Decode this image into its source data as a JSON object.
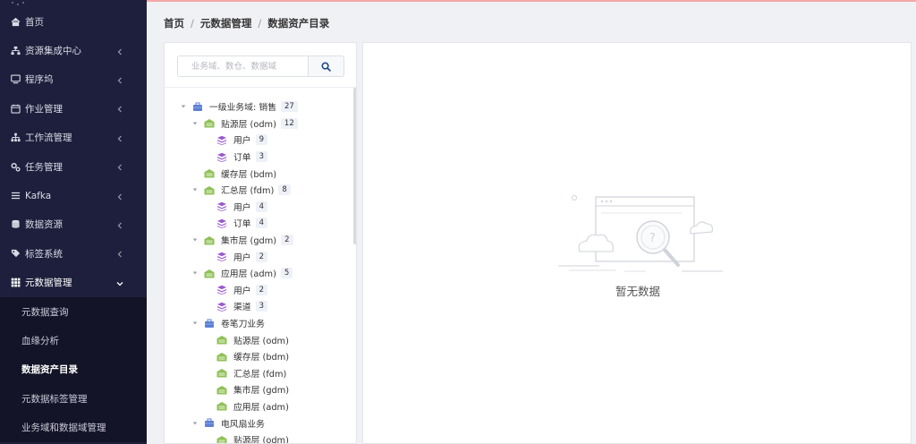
{
  "colors": {
    "sidebar_bg": "#1e1f3c",
    "submenu_bg": "#141428",
    "layer_icon": "#8fc157",
    "table_icon": "#9b59d0",
    "domain_icon": "#5b7fd4",
    "accent_line": "#f4a7a7"
  },
  "sidebar": {
    "items": [
      {
        "label": "首页",
        "icon": "home-icon",
        "has_arrow": false
      },
      {
        "label": "资源集成中心",
        "icon": "sitemap-icon",
        "has_arrow": true
      },
      {
        "label": "程序坞",
        "icon": "monitor-icon",
        "has_arrow": true
      },
      {
        "label": "作业管理",
        "icon": "calendar-icon",
        "has_arrow": true
      },
      {
        "label": "工作流管理",
        "icon": "hierarchy-icon",
        "has_arrow": true
      },
      {
        "label": "任务管理",
        "icon": "gears-icon",
        "has_arrow": true
      },
      {
        "label": "Kafka",
        "icon": "list-icon",
        "has_arrow": true
      },
      {
        "label": "数据资源",
        "icon": "database-icon",
        "has_arrow": true
      },
      {
        "label": "标签系统",
        "icon": "tag-icon",
        "has_arrow": true
      },
      {
        "label": "元数据管理",
        "icon": "grid-icon",
        "has_arrow": true,
        "open": true
      }
    ],
    "submenu": [
      {
        "label": "元数据查询",
        "active": false
      },
      {
        "label": "血缘分析",
        "active": false
      },
      {
        "label": "数据资产目录",
        "active": true
      },
      {
        "label": "元数据标签管理",
        "active": false
      },
      {
        "label": "业务域和数据域管理",
        "active": false
      }
    ]
  },
  "breadcrumb": {
    "home": "首页",
    "sep": "/",
    "parent": "元数据管理",
    "current": "数据资产目录"
  },
  "search": {
    "placeholder": "业务域、数仓、数据域",
    "button_icon": "search-icon"
  },
  "tree": [
    {
      "level": 0,
      "label": "一级业务域: 销售",
      "count": "27",
      "icon": "domain",
      "arrow": true
    },
    {
      "level": 1,
      "label": "贴源层 (odm)",
      "count": "12",
      "icon": "layer",
      "arrow": true
    },
    {
      "level": 2,
      "label": "用户",
      "count": "9",
      "icon": "table",
      "arrow": false
    },
    {
      "level": 2,
      "label": "订单",
      "count": "3",
      "icon": "table",
      "arrow": false
    },
    {
      "level": 1,
      "label": "缓存层 (bdm)",
      "count": "",
      "icon": "layer",
      "arrow": false
    },
    {
      "level": 1,
      "label": "汇总层 (fdm)",
      "count": "8",
      "icon": "layer",
      "arrow": true
    },
    {
      "level": 2,
      "label": "用户",
      "count": "4",
      "icon": "table",
      "arrow": false
    },
    {
      "level": 2,
      "label": "订单",
      "count": "4",
      "icon": "table",
      "arrow": false
    },
    {
      "level": 1,
      "label": "集市层 (gdm)",
      "count": "2",
      "icon": "layer",
      "arrow": true
    },
    {
      "level": 2,
      "label": "用户",
      "count": "2",
      "icon": "table",
      "arrow": false
    },
    {
      "level": 1,
      "label": "应用层 (adm)",
      "count": "5",
      "icon": "layer",
      "arrow": true
    },
    {
      "level": 2,
      "label": "用户",
      "count": "2",
      "icon": "table",
      "arrow": false
    },
    {
      "level": 2,
      "label": "渠道",
      "count": "3",
      "icon": "table",
      "arrow": false
    },
    {
      "level": 1,
      "label": "卷笔刀业务",
      "count": "",
      "icon": "domain",
      "arrow": true
    },
    {
      "level": 2,
      "label": "贴源层 (odm)",
      "count": "",
      "icon": "layer",
      "arrow": false
    },
    {
      "level": 2,
      "label": "缓存层 (bdm)",
      "count": "",
      "icon": "layer",
      "arrow": false
    },
    {
      "level": 2,
      "label": "汇总层 (fdm)",
      "count": "",
      "icon": "layer",
      "arrow": false
    },
    {
      "level": 2,
      "label": "集市层 (gdm)",
      "count": "",
      "icon": "layer",
      "arrow": false
    },
    {
      "level": 2,
      "label": "应用层 (adm)",
      "count": "",
      "icon": "layer",
      "arrow": false
    },
    {
      "level": 1,
      "label": "电风扇业务",
      "count": "",
      "icon": "domain",
      "arrow": true
    },
    {
      "level": 2,
      "label": "贴源层 (odm)",
      "count": "",
      "icon": "layer",
      "arrow": false
    }
  ],
  "empty": {
    "text": "暂无数据",
    "icon": "no-data-illustration"
  }
}
